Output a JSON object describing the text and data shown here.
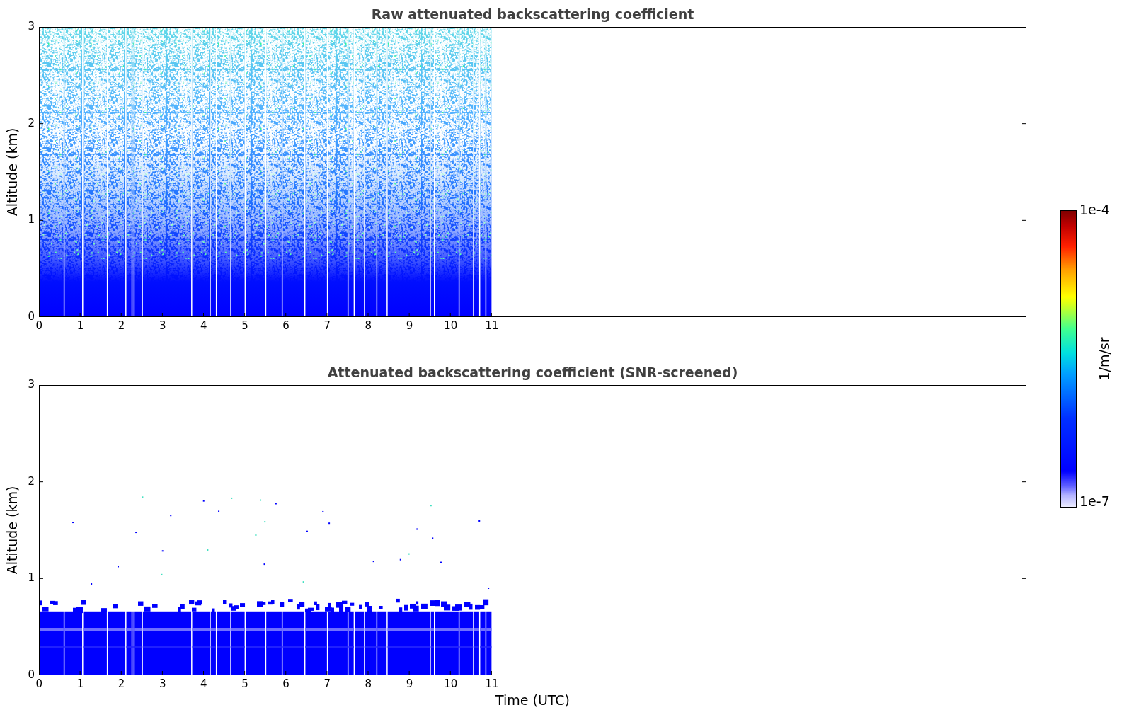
{
  "panels": [
    {
      "kind": "raw",
      "title": "Raw attenuated backscattering coefficient",
      "ylabel": "Altitude (km)",
      "yticks": [
        "3",
        "2",
        "1",
        "0"
      ],
      "xticks": [
        "0",
        "1",
        "2",
        "3",
        "4",
        "5",
        "6",
        "7",
        "8",
        "9",
        "10",
        "11"
      ]
    },
    {
      "kind": "screened",
      "title": "Attenuated backscattering coefficient (SNR-screened)",
      "ylabel": "Altitude (km)",
      "yticks": [
        "3",
        "2",
        "1",
        "0"
      ],
      "xticks": [
        "0",
        "1",
        "2",
        "3",
        "4",
        "5",
        "6",
        "7",
        "8",
        "9",
        "10",
        "11"
      ],
      "xlabel": "Time (UTC)"
    }
  ],
  "colorbar": {
    "max": "1e-4",
    "min": "1e-7",
    "label": "1/m/sr"
  }
}
